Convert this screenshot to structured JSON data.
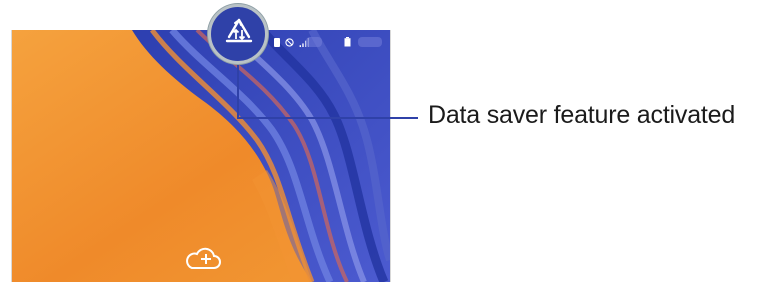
{
  "callout": {
    "label": "Data saver feature activated"
  },
  "magnifier": {
    "icon": "data-saver-icon"
  },
  "statusbar": {
    "icons": [
      "sim-icon",
      "no-access-icon",
      "signal-icon",
      "battery-icon"
    ]
  },
  "home_screen": {
    "add_icon": "cloud-add-icon"
  },
  "colors": {
    "accent_blue": "#2f41a8",
    "callout_line": "#2f41a8",
    "wallpaper_orange": "#f08a2c",
    "wallpaper_blue": "#3a4bbd"
  }
}
